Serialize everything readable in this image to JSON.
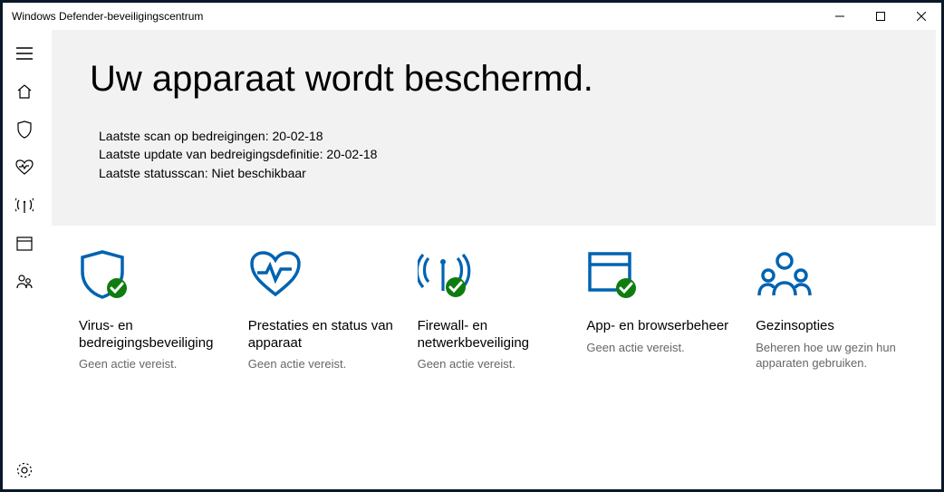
{
  "window": {
    "title": "Windows Defender-beveiligingscentrum"
  },
  "hero": {
    "heading": "Uw apparaat wordt beschermd.",
    "status": {
      "threat_scan_label": "Laatste scan op bedreigingen:",
      "threat_scan_value": "20-02-18",
      "definition_label": "Laatste update van bedreigingsdefinitie:",
      "definition_value": "20-02-18",
      "health_label": "Laatste statusscan:",
      "health_value": "Niet beschikbaar"
    }
  },
  "tiles": [
    {
      "icon": "shield-check-icon",
      "title": "Virus- en bedreigingsbeveiliging",
      "subtitle": "Geen actie vereist."
    },
    {
      "icon": "heart-health-icon",
      "title": "Prestaties en status van apparaat",
      "subtitle": "Geen actie vereist."
    },
    {
      "icon": "firewall-icon",
      "title": "Firewall- en netwerkbeveiliging",
      "subtitle": "Geen actie vereist."
    },
    {
      "icon": "app-browser-icon",
      "title": "App- en browserbeheer",
      "subtitle": "Geen actie vereist."
    },
    {
      "icon": "family-icon",
      "title": "Gezinsopties",
      "subtitle": "Beheren hoe uw gezin hun apparaten gebruiken."
    }
  ],
  "colors": {
    "accent_blue": "#0063B1",
    "check_green": "#107c10"
  }
}
